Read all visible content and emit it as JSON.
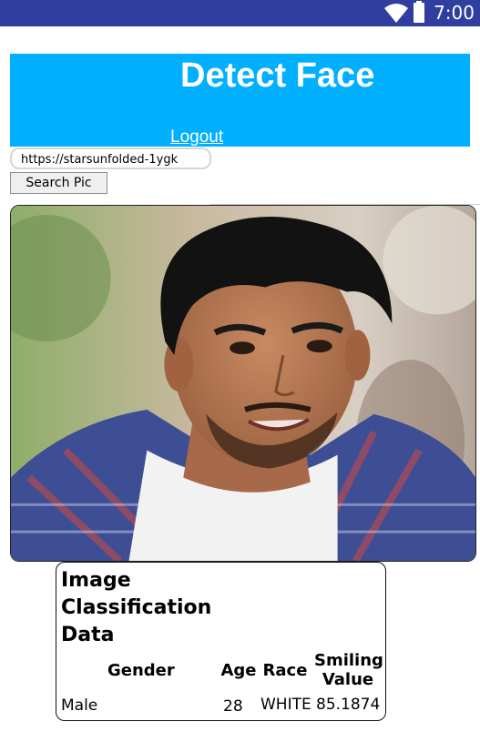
{
  "status_bar": {
    "time": "7:00"
  },
  "header": {
    "title": "Detect Face",
    "logout_label": "Logout"
  },
  "search": {
    "url_value": "https://starsunfolded-1ygk",
    "button_label": "Search Pic"
  },
  "result": {
    "heading": "Image Classification Data",
    "columns": [
      "Gender",
      "Age",
      "Race",
      "Smiling Value"
    ],
    "row": {
      "gender": "Male",
      "age": "28",
      "race": "WHITE",
      "smiling": "85.1874"
    }
  },
  "colors": {
    "status_bar": "#303f9f",
    "header": "#00b0ff"
  }
}
